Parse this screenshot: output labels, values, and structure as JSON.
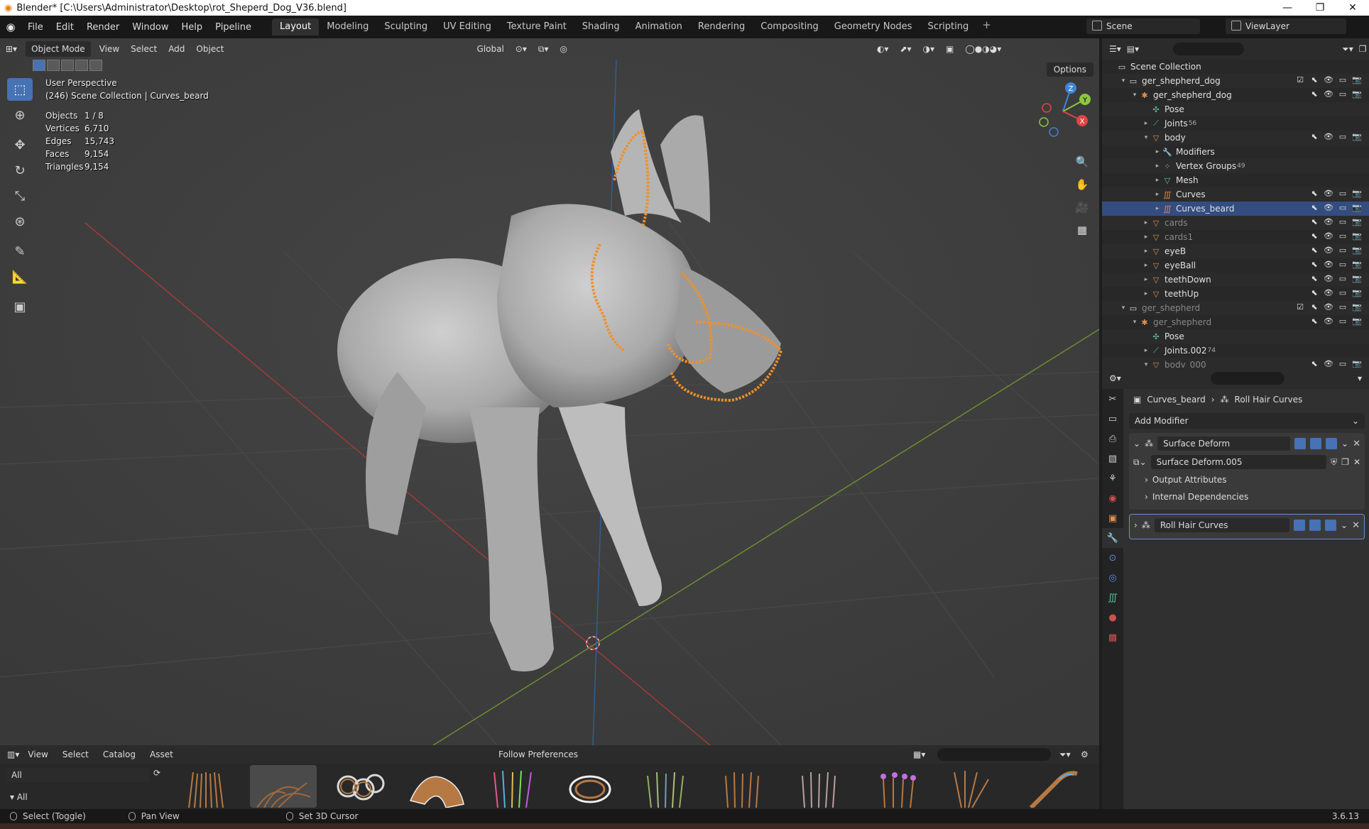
{
  "window": {
    "title": "Blender* [C:\\Users\\Administrator\\Desktop\\rot_Sheperd_Dog_V36.blend]",
    "controls": [
      "—",
      "❐",
      "✕"
    ]
  },
  "menubar": {
    "items": [
      "File",
      "Edit",
      "Render",
      "Window",
      "Help",
      "Pipeline"
    ],
    "workspaces": [
      "Layout",
      "Modeling",
      "Sculpting",
      "UV Editing",
      "Texture Paint",
      "Shading",
      "Animation",
      "Rendering",
      "Compositing",
      "Geometry Nodes",
      "Scripting"
    ],
    "active_workspace": "Layout",
    "add": "+",
    "scene": "Scene",
    "view_layer": "ViewLayer"
  },
  "viewport": {
    "mode": "Object Mode",
    "menus": [
      "View",
      "Select",
      "Add",
      "Object"
    ],
    "orientation": "Global",
    "options": "Options",
    "perspective": "User Perspective",
    "collection_info": "(246) Scene Collection | Curves_beard",
    "stats": [
      {
        "label": "Objects",
        "value": "1 / 8"
      },
      {
        "label": "Vertices",
        "value": "6,710"
      },
      {
        "label": "Edges",
        "value": "15,743"
      },
      {
        "label": "Faces",
        "value": "9,154"
      },
      {
        "label": "Triangles",
        "value": "9,154"
      }
    ],
    "gizmo_axes": [
      "Z",
      "Y",
      "X"
    ]
  },
  "outliner": {
    "rows": [
      {
        "label": "Scene Collection",
        "indent": 0,
        "icon": "collection-icon",
        "arrow": "",
        "right": false
      },
      {
        "label": "ger_shepherd_dog",
        "indent": 1,
        "icon": "collection-icon",
        "arrow": "▾",
        "right": true,
        "check": true
      },
      {
        "label": "ger_shepherd_dog",
        "indent": 2,
        "icon": "armature-icon",
        "arrow": "▾",
        "right": true
      },
      {
        "label": "Pose",
        "indent": 3,
        "icon": "pose-icon",
        "arrow": "",
        "right": false
      },
      {
        "label": "Joints",
        "indent": 3,
        "icon": "bone-icon",
        "arrow": "▸",
        "right": false,
        "count": "56"
      },
      {
        "label": "body",
        "indent": 3,
        "icon": "mesh-icon",
        "arrow": "▾",
        "right": true
      },
      {
        "label": "Modifiers",
        "indent": 4,
        "icon": "wrench-icon",
        "arrow": "▸",
        "right": false
      },
      {
        "label": "Vertex Groups",
        "indent": 4,
        "icon": "vertex-groups-icon",
        "arrow": "▸",
        "right": false,
        "count": "49"
      },
      {
        "label": "Mesh",
        "indent": 4,
        "icon": "mesh-data-icon",
        "arrow": "▸",
        "right": false
      },
      {
        "label": "Curves",
        "indent": 4,
        "icon": "curves-icon",
        "arrow": "▸",
        "right": true
      },
      {
        "label": "Curves_beard",
        "indent": 4,
        "icon": "curves-icon",
        "arrow": "▸",
        "right": true,
        "selected": true
      },
      {
        "label": "cards",
        "indent": 3,
        "icon": "mesh-icon",
        "arrow": "▸",
        "right": true,
        "dim": true
      },
      {
        "label": "cards1",
        "indent": 3,
        "icon": "mesh-icon",
        "arrow": "▸",
        "right": true,
        "dim": true
      },
      {
        "label": "eyeB",
        "indent": 3,
        "icon": "mesh-icon",
        "arrow": "▸",
        "right": true
      },
      {
        "label": "eyeBall",
        "indent": 3,
        "icon": "mesh-icon",
        "arrow": "▸",
        "right": true
      },
      {
        "label": "teethDown",
        "indent": 3,
        "icon": "mesh-icon",
        "arrow": "▸",
        "right": true
      },
      {
        "label": "teethUp",
        "indent": 3,
        "icon": "mesh-icon",
        "arrow": "▸",
        "right": true
      },
      {
        "label": "ger_shepherd",
        "indent": 1,
        "icon": "collection-icon",
        "arrow": "▾",
        "right": true,
        "dim": true,
        "check": true
      },
      {
        "label": "ger_shepherd",
        "indent": 2,
        "icon": "armature-icon",
        "arrow": "▾",
        "right": true,
        "dim": true
      },
      {
        "label": "Pose",
        "indent": 3,
        "icon": "pose-icon",
        "arrow": "",
        "right": false
      },
      {
        "label": "Joints.002",
        "indent": 3,
        "icon": "bone-icon",
        "arrow": "▸",
        "right": false,
        "count": "74"
      },
      {
        "label": "body_000",
        "indent": 3,
        "icon": "mesh-icon",
        "arrow": "▾",
        "right": true,
        "dim": true
      }
    ]
  },
  "properties": {
    "breadcrumb_object": "Curves_beard",
    "breadcrumb_modifier": "Roll Hair Curves",
    "add_modifier": "Add Modifier",
    "modifiers": [
      {
        "name": "Surface Deform",
        "node_group": "Surface Deform.005",
        "subpanels": [
          "Output Attributes",
          "Internal Dependencies"
        ],
        "expanded": true
      },
      {
        "name": "Roll Hair Curves",
        "expanded": false
      }
    ]
  },
  "asset_browser": {
    "menus": [
      "View",
      "Select",
      "Catalog",
      "Asset"
    ],
    "library": "Follow Preferences",
    "catalog_filter": "All",
    "tree_root": "All"
  },
  "statusbar": {
    "select": "Select (Toggle)",
    "pan": "Pan View",
    "cursor": "Set 3D Cursor",
    "version": "3.6.13"
  },
  "colors": {
    "accent": "#4772b3",
    "selection_outline": "#f0902a",
    "axis_x": "#e04545",
    "axis_y": "#8dc63f",
    "axis_z": "#3d86d8"
  }
}
